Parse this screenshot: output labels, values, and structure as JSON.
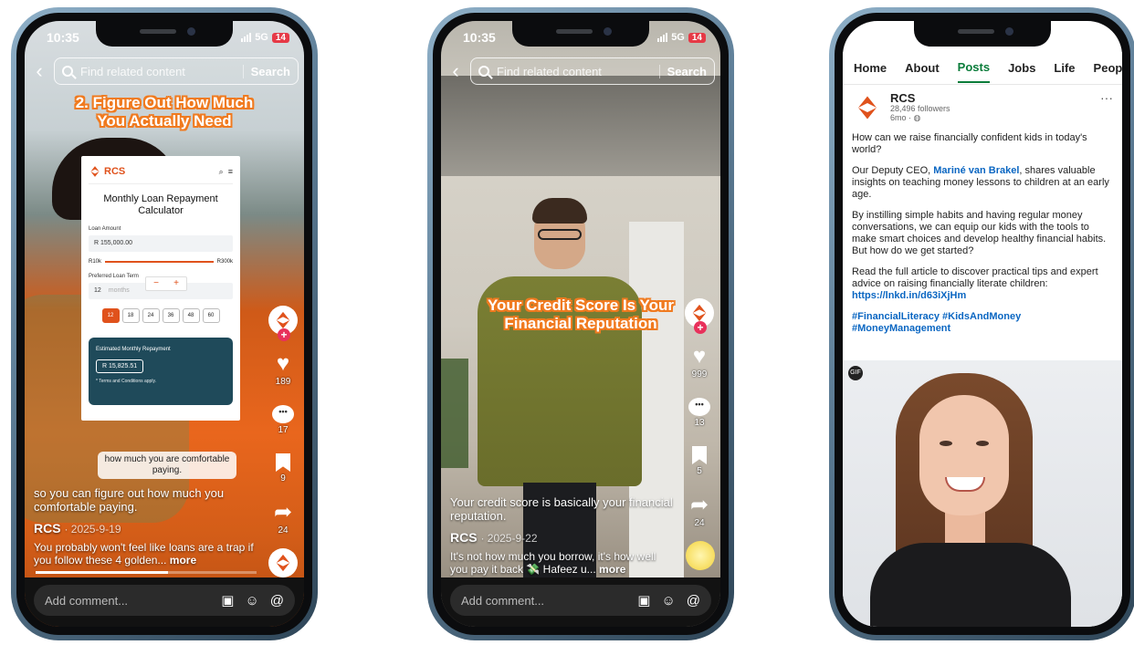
{
  "phone1": {
    "status": {
      "time": "10:35",
      "network": "5G",
      "battery": "14"
    },
    "search": {
      "placeholder": "Find related content",
      "button": "Search"
    },
    "overlay_title": "2. Figure Out How Much You Actually Need",
    "calculator": {
      "brand": "RCS",
      "title": "Monthly Loan Repayment Calculator",
      "loan_amount_label": "Loan Amount",
      "loan_amount_value": "R 155,000.00",
      "slider_min": "R10k",
      "slider_max": "R300k",
      "term_label": "Preferred Loan Term",
      "term_value": "12",
      "term_unit": "months",
      "term_options": [
        "12",
        "18",
        "24",
        "36",
        "48",
        "60"
      ],
      "selected_term": "12",
      "estimate_label": "Estimated Monthly Repayment",
      "estimate_value": "R 15,825.51",
      "terms_note": "* Terms and Conditions apply."
    },
    "subtitle_bubble": "how much you are comfortable paying.",
    "rail": {
      "likes": "189",
      "comments": "17",
      "saves": "9",
      "shares": "24"
    },
    "caption": {
      "subtitle": "so you can figure out how much you comfortable paying.",
      "author": "RCS",
      "date": "· 2025-9-19",
      "description": "You probably won't feel like loans are a trap if you follow these 4 golden...",
      "more": "more"
    },
    "progress": 0.6,
    "comment_placeholder": "Add comment..."
  },
  "phone2": {
    "status": {
      "time": "10:35",
      "network": "5G",
      "battery": "14"
    },
    "search": {
      "placeholder": "Find related content",
      "button": "Search"
    },
    "overlay_title": "Your Credit Score Is Your Financial Reputation",
    "rail": {
      "likes": "999",
      "comments": "13",
      "saves": "5",
      "shares": "24"
    },
    "caption": {
      "subtitle": "Your credit score is basically your financial reputation.",
      "author": "RCS",
      "date": "· 2025-9-22",
      "description": "It's not how much you borrow, it's how well you pay it back 💸 Hafeez u...",
      "more": "more"
    },
    "comment_placeholder": "Add comment..."
  },
  "phone3": {
    "tabs": [
      "Home",
      "About",
      "Posts",
      "Jobs",
      "Life",
      "People"
    ],
    "active_tab": "Posts",
    "post": {
      "company": "RCS",
      "followers": "28,496 followers",
      "age": "6mo ·",
      "p1": "How can we raise financially confident kids in today's world?",
      "p2_prefix": "Our Deputy CEO, ",
      "p2_mention": "Mariné van Brakel",
      "p2_suffix": ", shares valuable insights on teaching money lessons to children at an early age.",
      "p3": "By instilling simple habits and having regular money conversations, we can equip our kids with the tools to make smart choices and develop healthy financial habits. But how do we get started?",
      "p4_prefix": "Read the full article to discover practical tips and expert advice on raising financially literate children: ",
      "p4_link": "https://lnkd.in/d63iXjHm",
      "hashtags": "#FinancialLiteracy #KidsAndMoney #MoneyManagement",
      "gif_badge": "GIF"
    }
  },
  "colors": {
    "rcs_orange": "#e0521c",
    "linkedin_green": "#0a7c3a",
    "link_blue": "#0a66c2"
  }
}
